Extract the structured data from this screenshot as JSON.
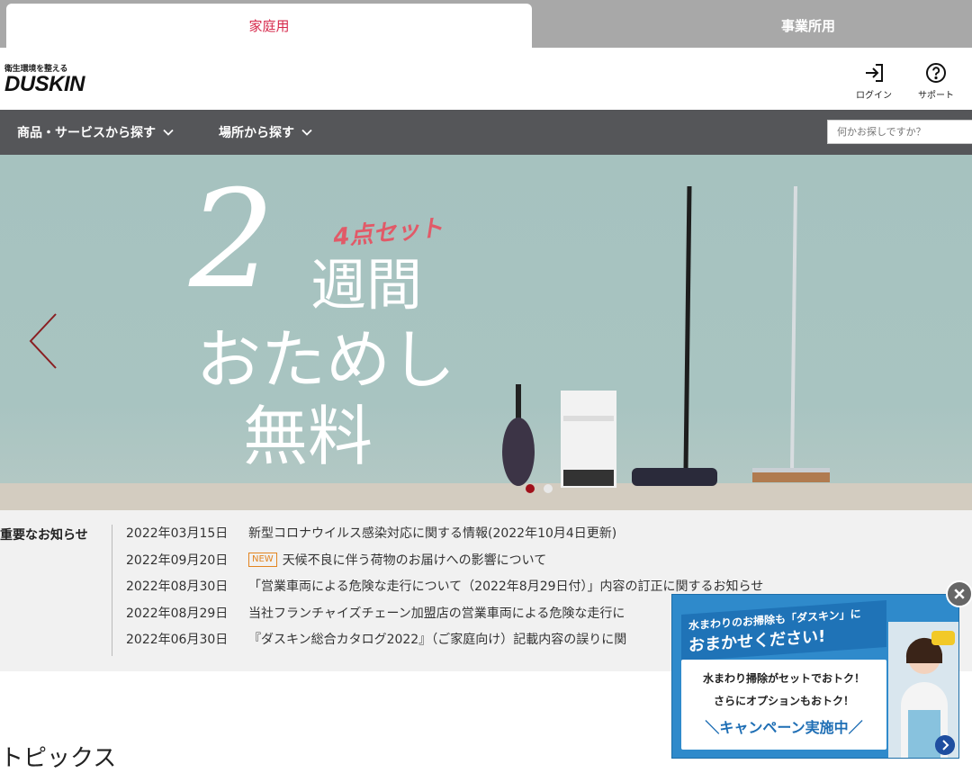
{
  "tabs": {
    "home": "家庭用",
    "business": "事業所用"
  },
  "header": {
    "logo_tagline": "衛生環境を整える",
    "logo_text": "DUSKIN",
    "login_label": "ログイン",
    "support_label": "サポート"
  },
  "nav": {
    "products": "商品・サービスから探す",
    "places": "場所から探す",
    "search_placeholder": "何かお探しですか？"
  },
  "hero": {
    "two": "2",
    "set_label": "4点セット",
    "weeks": "週間",
    "trial": "おためし",
    "free": "無料",
    "slide_count": 2,
    "active_slide": 1
  },
  "notices": {
    "title": "重要なお知らせ",
    "new_badge": "NEW",
    "items": [
      {
        "date": "2022年03月15日",
        "text": "新型コロナウイルス感染対応に関する情報(2022年10月4日更新)",
        "is_new": false
      },
      {
        "date": "2022年09月20日",
        "text": "天候不良に伴う荷物のお届けへの影響について",
        "is_new": true
      },
      {
        "date": "2022年08月30日",
        "text": "「営業車両による危険な走行について（2022年8月29日付）」内容の訂正に関するお知らせ",
        "is_new": false
      },
      {
        "date": "2022年08月29日",
        "text": "当社フランチャイズチェーン加盟店の営業車両による危険な走行に",
        "is_new": false
      },
      {
        "date": "2022年06月30日",
        "text": "『ダスキン総合カタログ2022』（ご家庭向け）記載内容の誤りに関",
        "is_new": false
      }
    ]
  },
  "topics": {
    "title": "トピックス"
  },
  "popup": {
    "head_line1": "水まわりのお掃除も「ダスキン」に",
    "head_line2": "おまかせください!",
    "line1": "水まわり掃除がセットでおトク！",
    "line2": "さらにオプションもおトク！",
    "campaign": "＼キャンペーン実施中／"
  },
  "colors": {
    "accent_red": "#d6284b",
    "nav_bg": "#555659",
    "tab_bg": "#a8a8a8",
    "new_badge": "#e38520",
    "popup_blue": "#2f8acb"
  }
}
